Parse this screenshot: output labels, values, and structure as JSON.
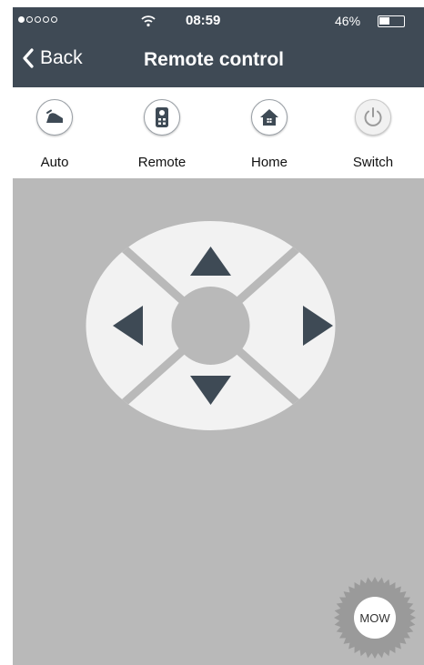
{
  "status_bar": {
    "time": "08:59",
    "battery_percent": "46%",
    "signal_bars_filled": 1,
    "signal_bars_total": 5,
    "battery_level": 0.46
  },
  "nav": {
    "back_label": "Back",
    "title": "Remote control"
  },
  "toolbar": {
    "items": [
      {
        "label": "Auto",
        "icon": "auto-mow-icon"
      },
      {
        "label": "Remote",
        "icon": "remote-icon"
      },
      {
        "label": "Home",
        "icon": "home-icon"
      },
      {
        "label": "Switch",
        "icon": "power-icon"
      }
    ]
  },
  "dpad": {
    "directions": [
      "up",
      "down",
      "left",
      "right"
    ]
  },
  "mow_button": {
    "label": "MOW"
  },
  "colors": {
    "header": "#3f4a55",
    "control_bg": "#b9b9b9",
    "dpad_fill": "#f2f2f2",
    "arrow": "#3e4a55",
    "mow_gear": "#9a9a9a"
  }
}
